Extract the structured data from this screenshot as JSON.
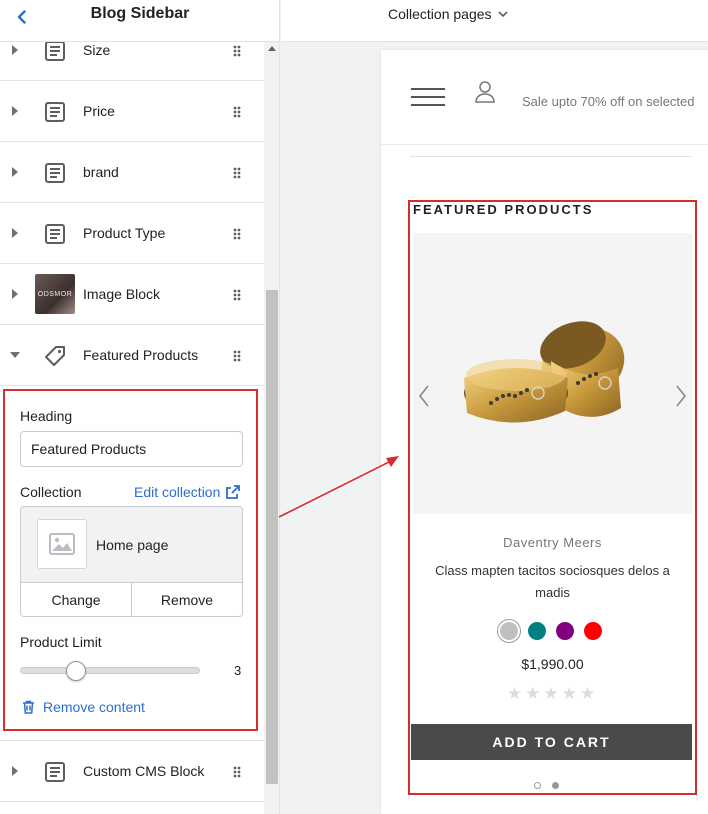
{
  "sidebar": {
    "title": "Blog Sidebar",
    "items": [
      {
        "label": "Size",
        "icon": "text-block-icon"
      },
      {
        "label": "Price",
        "icon": "text-block-icon"
      },
      {
        "label": "brand",
        "icon": "text-block-icon"
      },
      {
        "label": "Product Type",
        "icon": "text-block-icon"
      },
      {
        "label": "Image Block",
        "icon": "image-thumbnail",
        "thumb_text": "ODSMOR"
      },
      {
        "label": "Featured Products",
        "icon": "tag-icon",
        "expanded": true
      }
    ],
    "after_items": [
      {
        "label": "Custom CMS Block",
        "icon": "text-block-icon"
      }
    ]
  },
  "editor": {
    "heading_label": "Heading",
    "heading_value": "Featured Products",
    "collection_label": "Collection",
    "edit_collection": "Edit collection",
    "collection_name": "Home page",
    "change_label": "Change",
    "remove_label": "Remove",
    "limit_label": "Product Limit",
    "limit_value": "3",
    "limit_fraction": 0.31,
    "remove_content": "Remove content"
  },
  "topbar": {
    "page_select": "Collection pages"
  },
  "preview": {
    "promo": "Sale upto 70% off on selected",
    "section_title": "FEATURED PRODUCTS",
    "vendor": "Daventry Meers",
    "product_name": "Class mapten tacitos sociosques delos a madis",
    "swatches": [
      "#c0c0c0",
      "#008080",
      "#800080",
      "#ff0000"
    ],
    "selected_swatch": 0,
    "price": "$1,990.00",
    "rating": 0,
    "cart_label": "ADD TO CART",
    "slide_count": 2,
    "active_slide": 1
  },
  "colors": {
    "accent": "#d72c2c",
    "link": "#2c6ecb"
  }
}
